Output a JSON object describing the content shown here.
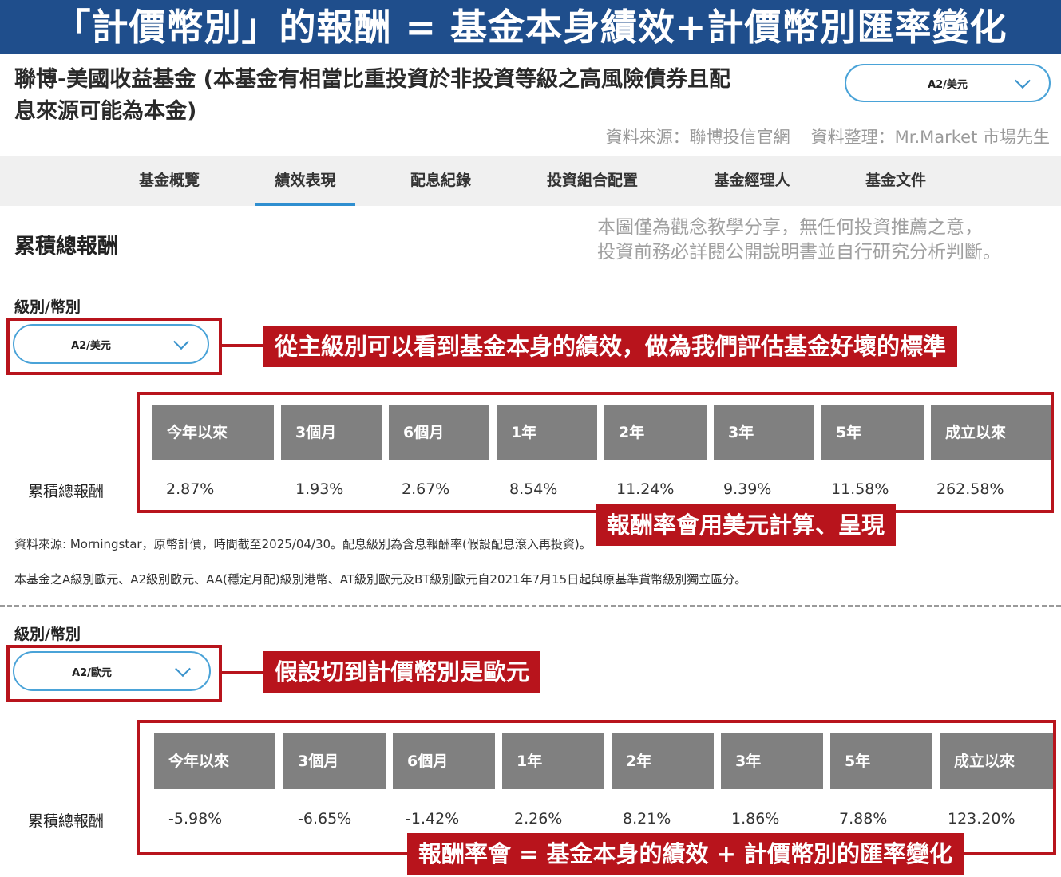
{
  "banner": {
    "title": "「計價幣別」的報酬 = 基金本身績效+計價幣別匯率變化"
  },
  "fund": {
    "name_line1": "聯博-美國收益基金 (本基金有相當比重投資於非投資等級之高風險債券且配",
    "name_line2": "息來源可能為本金)",
    "top_select_value": "A2/美元"
  },
  "source": {
    "left": "資料來源：聯博投信官網",
    "right": "資料整理：Mr.Market 市場先生"
  },
  "tabs": [
    {
      "label": "基金概覽"
    },
    {
      "label": "績效表現"
    },
    {
      "label": "配息紀錄"
    },
    {
      "label": "投資組合配置"
    },
    {
      "label": "基金經理人"
    },
    {
      "label": "基金文件"
    }
  ],
  "section_title": "累積總報酬",
  "disclaimer": {
    "line1": "本圖僅為觀念教學分享，無任何投資推薦之意，",
    "line2": "投資前務必詳閱公開說明書並自行研究分析判斷。"
  },
  "block1": {
    "class_label": "級別/幣別",
    "select_value": "A2/美元",
    "callout_select": "從主級別可以看到基金本身的績效，做為我們評估基金好壞的標準",
    "headers": [
      "今年以來",
      "3個月",
      "6個月",
      "1年",
      "2年",
      "3年",
      "5年",
      "成立以來"
    ],
    "row_label": "累積總報酬",
    "values": [
      "2.87%",
      "1.93%",
      "2.67%",
      "8.54%",
      "11.24%",
      "9.39%",
      "11.58%",
      "262.58%"
    ],
    "callout_table": "報酬率會用美元計算、呈現"
  },
  "notes": {
    "line1": "資料來源: Morningstar，原幣計價，時間截至2025/04/30。配息級別為含息報酬率(假設配息滾入再投資)。",
    "line2": "本基金之A級別歐元、A2級別歐元、AA(穩定月配)級別港幣、AT級別歐元及BT級別歐元自2021年7月15日起與原基準貨幣級別獨立區分。"
  },
  "block2": {
    "class_label": "級別/幣別",
    "select_value": "A2/歐元",
    "callout_select": "假設切到計價幣別是歐元",
    "headers": [
      "今年以來",
      "3個月",
      "6個月",
      "1年",
      "2年",
      "3年",
      "5年",
      "成立以來"
    ],
    "row_label": "累積總報酬",
    "values": [
      "-5.98%",
      "-6.65%",
      "-1.42%",
      "2.26%",
      "8.21%",
      "1.86%",
      "7.88%",
      "123.20%"
    ],
    "callout_table": "報酬率會 = 基金本身的績效 + 計價幣別的匯率變化"
  },
  "colors": {
    "banner": "#1f4e8c",
    "accent_red": "#b8141c",
    "tab_active": "#2f8fd0",
    "header_gray": "#808080"
  }
}
